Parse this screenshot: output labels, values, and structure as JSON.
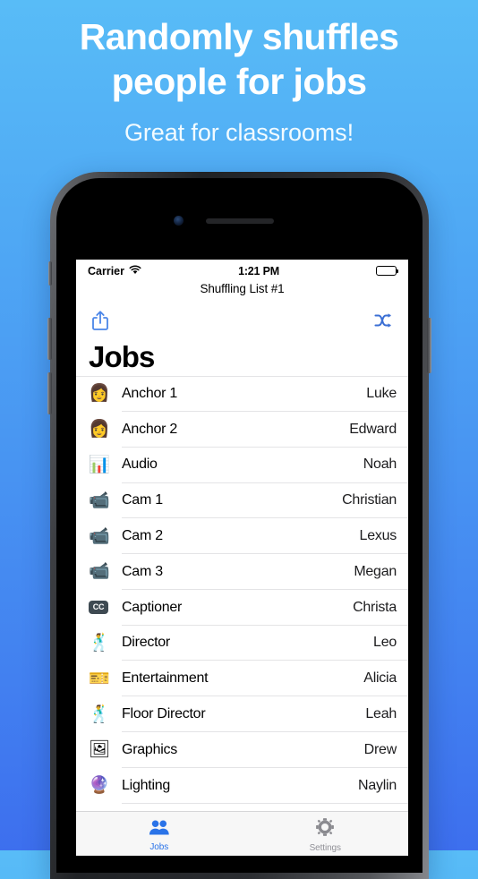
{
  "promo": {
    "headline": "Randomly shuffles people for jobs",
    "headline_line1": "Randomly shuffles",
    "headline_line2": "people for jobs",
    "subtitle": "Great for classrooms!"
  },
  "colors": {
    "bg_top": "#58bcf7",
    "bg_bottom": "#3d6fee",
    "accent_blue": "#2a73e8",
    "tab_inactive": "#919197",
    "separator": "#e4e4e6",
    "tabbar_bg": "#f7f7f7"
  },
  "phone": {
    "status_bar": {
      "carrier": "Carrier",
      "wifi_icon": "wifi-icon",
      "time": "1:21 PM",
      "battery_icon": "battery-full-icon"
    },
    "nav": {
      "title": "Shuffling List #1",
      "share_icon": "share-icon",
      "shuffle_icon": "shuffle-icon"
    },
    "large_title": "Jobs",
    "list": {
      "rows": [
        {
          "emoji": "👩",
          "icon_name": "person-woman-icon",
          "job": "Anchor 1",
          "person": "Luke"
        },
        {
          "emoji": "👩",
          "icon_name": "person-woman-icon",
          "job": "Anchor 2",
          "person": "Edward"
        },
        {
          "emoji": "📊",
          "icon_name": "level-slider-icon",
          "job": "Audio",
          "person": "Noah"
        },
        {
          "emoji": "📹",
          "icon_name": "video-camera-icon",
          "job": "Cam 1",
          "person": "Christian"
        },
        {
          "emoji": "📹",
          "icon_name": "video-camera-icon",
          "job": "Cam 2",
          "person": "Lexus"
        },
        {
          "emoji": "📹",
          "icon_name": "video-camera-icon",
          "job": "Cam 3",
          "person": "Megan"
        },
        {
          "emoji": "CC",
          "icon_name": "closed-captioning-icon",
          "job": "Captioner",
          "person": "Christa"
        },
        {
          "emoji": "🕺",
          "icon_name": "conductor-icon",
          "job": "Director",
          "person": "Leo"
        },
        {
          "emoji": "🎫",
          "icon_name": "ticket-icon",
          "job": "Entertainment",
          "person": "Alicia"
        },
        {
          "emoji": "🕺",
          "icon_name": "conductor-icon",
          "job": "Floor Director",
          "person": "Leah"
        },
        {
          "emoji": "🖼",
          "icon_name": "framed-picture-icon",
          "job": "Graphics",
          "person": "Drew"
        },
        {
          "emoji": "🔮",
          "icon_name": "spotlight-icon",
          "job": "Lighting",
          "person": "Naylin"
        }
      ]
    },
    "tabbar": {
      "tabs": [
        {
          "label": "Jobs",
          "icon_name": "people-icon",
          "active": true
        },
        {
          "label": "Settings",
          "icon_name": "gear-icon",
          "active": false
        }
      ]
    }
  }
}
